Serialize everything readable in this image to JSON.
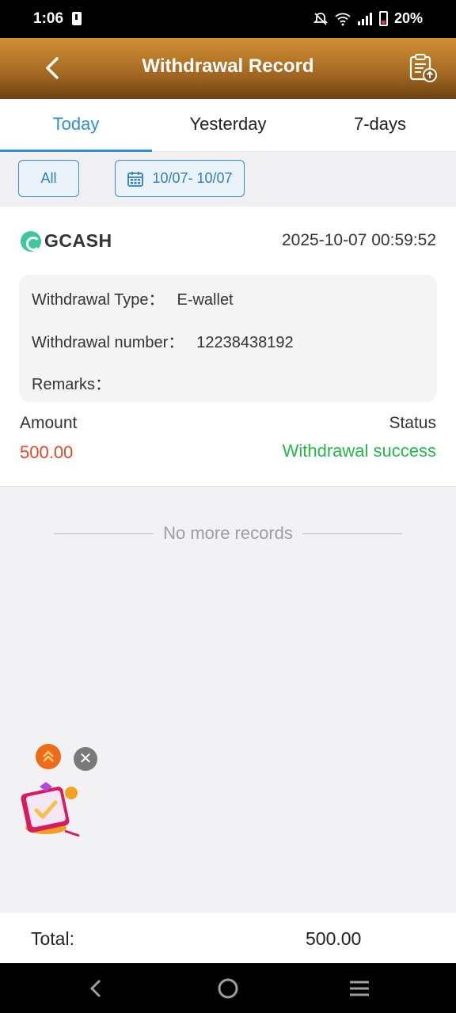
{
  "status_bar": {
    "time": "1:06",
    "battery": "20%"
  },
  "header": {
    "title": "Withdrawal Record"
  },
  "tabs": [
    {
      "label": "Today",
      "active": true
    },
    {
      "label": "Yesterday",
      "active": false
    },
    {
      "label": "7-days",
      "active": false
    }
  ],
  "filters": {
    "all_label": "All",
    "date_range": "10/07- 10/07"
  },
  "record": {
    "method": "GCASH",
    "datetime": "2025-10-07 00:59:52",
    "type_label": "Withdrawal Type：",
    "type_value": "E-wallet",
    "number_label": "Withdrawal number：",
    "number_value": "12238438192",
    "remarks_label": "Remarks：",
    "remarks_value": "",
    "amount_label": "Amount",
    "amount_value": "500.00",
    "status_label": "Status",
    "status_value": "Withdrawal success"
  },
  "no_more": "No more records",
  "footer": {
    "total_label": "Total:",
    "total_value": "500.00"
  },
  "colors": {
    "accent": "#2f8fd0",
    "amount": "#e04a2c",
    "success": "#22b84a",
    "header_top": "#d28f35",
    "header_bottom": "#6f4312"
  }
}
